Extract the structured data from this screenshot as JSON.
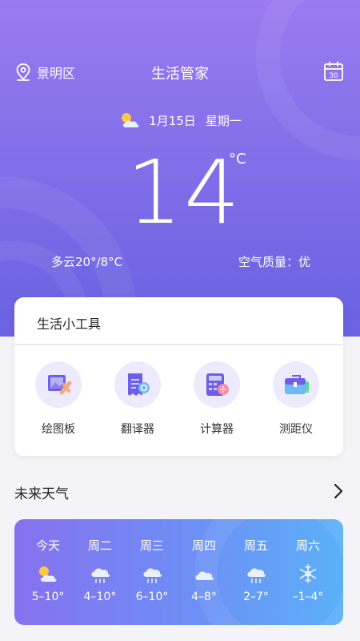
{
  "header": {
    "location": "景明区",
    "title": "生活管家",
    "calendar_day": "30"
  },
  "today": {
    "date": "1月15日",
    "weekday": "星期一",
    "temperature": "14",
    "unit": "°C",
    "condition_range": "多云20°/8°C",
    "air_quality": "空气质量：优"
  },
  "tools": {
    "title": "生活小工具",
    "items": [
      {
        "label": "绘图板",
        "icon": "drawing-board-icon"
      },
      {
        "label": "翻译器",
        "icon": "translator-icon"
      },
      {
        "label": "计算器",
        "icon": "calculator-icon"
      },
      {
        "label": "测距仪",
        "icon": "rangefinder-icon"
      }
    ]
  },
  "forecast": {
    "title": "未来天气",
    "days": [
      {
        "name": "今天",
        "range": "5–10°",
        "icon": "sun-cloud-icon"
      },
      {
        "name": "周二",
        "range": "4–10°",
        "icon": "rain-icon"
      },
      {
        "name": "周三",
        "range": "6–10°",
        "icon": "rain-icon"
      },
      {
        "name": "周四",
        "range": "4–8°",
        "icon": "cloud-icon"
      },
      {
        "name": "周五",
        "range": "2–7°",
        "icon": "rain-icon"
      },
      {
        "name": "周六",
        "range": "–1–4°",
        "icon": "snow-icon"
      }
    ]
  },
  "colors": {
    "hero_top": "#9a7bf0",
    "hero_bottom": "#6962e0",
    "accent": "#7c6ae8",
    "forecast_start": "#8771ee",
    "forecast_end": "#5bb0f8"
  }
}
